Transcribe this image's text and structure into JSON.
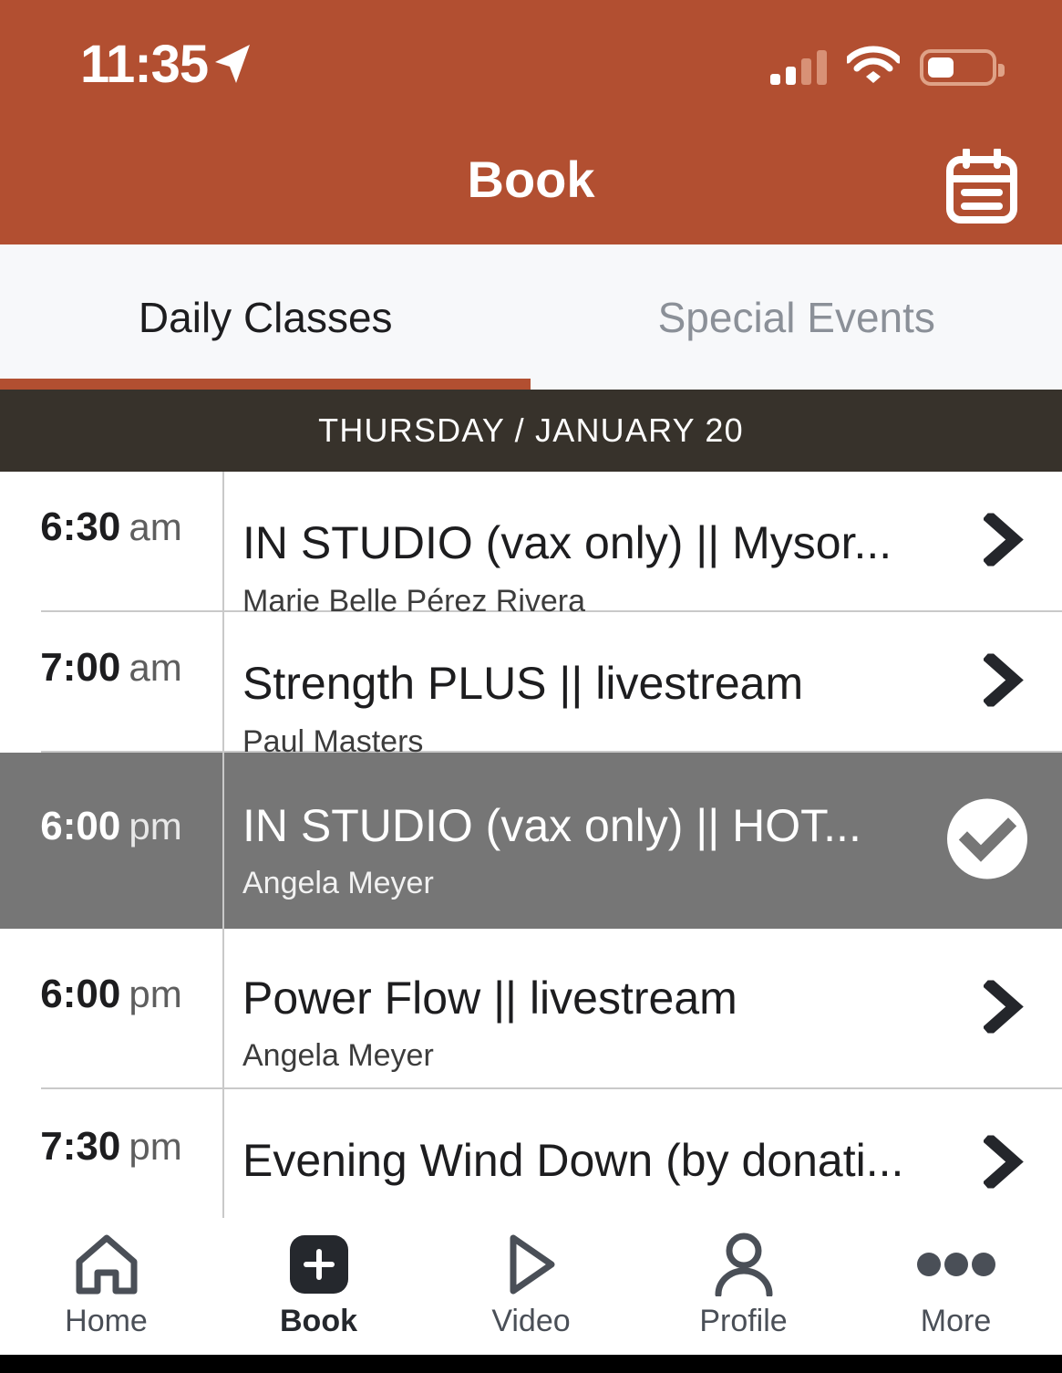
{
  "status_bar": {
    "time": "11:35",
    "location_icon": "location-arrow-icon",
    "signal_icon": "cellular-signal-icon",
    "wifi_icon": "wifi-icon",
    "battery_icon": "battery-low-icon"
  },
  "header": {
    "title": "Book",
    "calendar_icon": "calendar-icon",
    "background_color": "#b24f31"
  },
  "tabs": {
    "active_index": 0,
    "items": [
      {
        "label": "Daily Classes"
      },
      {
        "label": "Special Events"
      }
    ],
    "underline_color": "#b24f31"
  },
  "date_bar": {
    "label": "THURSDAY / JANUARY 20",
    "background_color": "#37322b"
  },
  "classes": [
    {
      "time": "6:30",
      "meridiem": "am",
      "title": "IN STUDIO (vax only)  || Mysor...",
      "teacher": "Marie Belle Pérez Rivera",
      "selected": false,
      "accessory_icon": "chevron-right-icon"
    },
    {
      "time": "7:00",
      "meridiem": "am",
      "title": "Strength PLUS || livestream",
      "teacher": "Paul Masters",
      "selected": false,
      "accessory_icon": "chevron-right-icon"
    },
    {
      "time": "6:00",
      "meridiem": "pm",
      "title": "IN STUDIO (vax only) || HOT...",
      "teacher": "Angela Meyer",
      "selected": true,
      "accessory_icon": "check-circle-icon"
    },
    {
      "time": "6:00",
      "meridiem": "pm",
      "title": "Power Flow  ||  livestream",
      "teacher": "Angela Meyer",
      "selected": false,
      "accessory_icon": "chevron-right-icon"
    },
    {
      "time": "7:30",
      "meridiem": "pm",
      "title": "Evening Wind Down (by donati...",
      "teacher": "",
      "selected": false,
      "accessory_icon": "chevron-right-icon"
    }
  ],
  "bottom_nav": {
    "active_index": 1,
    "items": [
      {
        "label": "Home",
        "icon": "home-icon"
      },
      {
        "label": "Book",
        "icon": "plus-square-icon"
      },
      {
        "label": "Video",
        "icon": "play-triangle-icon"
      },
      {
        "label": "Profile",
        "icon": "person-icon"
      },
      {
        "label": "More",
        "icon": "ellipsis-icon"
      }
    ]
  },
  "colors": {
    "brand_orange": "#b24f31",
    "date_bar_dark": "#37322b",
    "selected_row_gray": "#767676",
    "tab_bg": "#f7f8fa"
  }
}
